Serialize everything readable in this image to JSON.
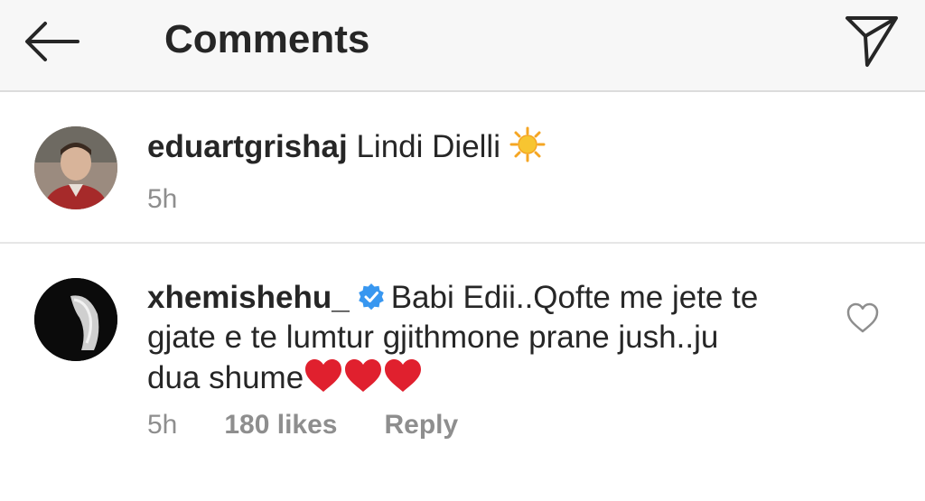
{
  "header": {
    "title": "Comments",
    "back_icon": "arrow-left-icon",
    "send_icon": "paper-plane-icon"
  },
  "caption": {
    "username": "eduartgrishaj",
    "text": "Lindi Dielli",
    "emoji": "sun-icon",
    "time": "5h"
  },
  "comment": {
    "username": "xhemishehu_",
    "verified": true,
    "line1": "Babi Edii..Qofte me jete te",
    "line2": "gjate e te lumtur gjithmone prane jush..ju",
    "line3": "dua shume",
    "emoji": "red-heart-icon",
    "time": "5h",
    "likes": "180 likes",
    "reply": "Reply",
    "like_icon": "heart-outline-icon"
  },
  "colors": {
    "verified_blue": "#3897f0",
    "heart_red": "#e0202e",
    "meta_gray": "#8e8e8e",
    "header_bg": "#f7f7f7"
  }
}
